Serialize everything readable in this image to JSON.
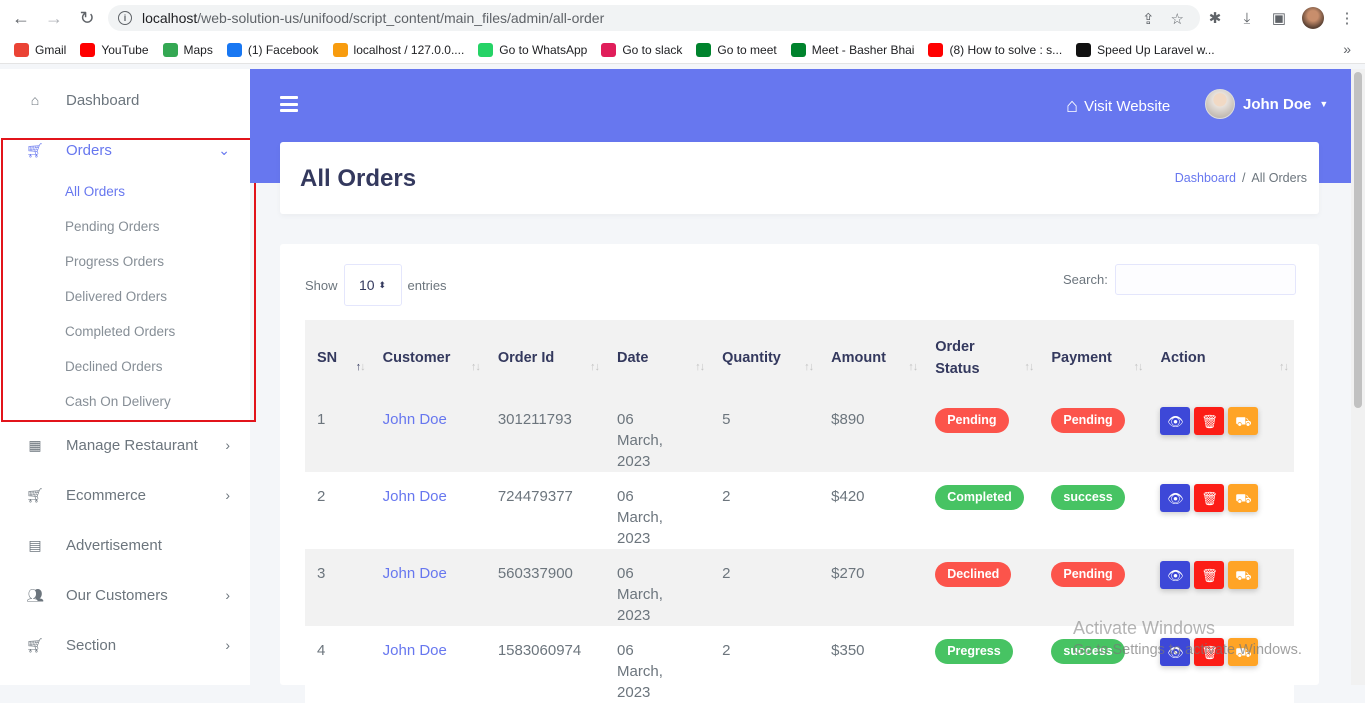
{
  "browser": {
    "url_host": "localhost",
    "url_path": "/web-solution-us/unifood/script_content/main_files/admin/all-order",
    "bookmarks": [
      {
        "label": "Gmail",
        "icon": "gmail-icon",
        "color": "#ea4335"
      },
      {
        "label": "YouTube",
        "icon": "youtube-icon",
        "color": "#ff0000"
      },
      {
        "label": "Maps",
        "icon": "maps-icon",
        "color": "#34a853"
      },
      {
        "label": "(1) Facebook",
        "icon": "facebook-icon",
        "color": "#1877f2"
      },
      {
        "label": "localhost / 127.0.0....",
        "icon": "phpmyadmin-icon",
        "color": "#f89c0e"
      },
      {
        "label": "Go to WhatsApp",
        "icon": "whatsapp-icon",
        "color": "#25d366"
      },
      {
        "label": "Go to slack",
        "icon": "slack-icon",
        "color": "#e01e5a"
      },
      {
        "label": "Go to meet",
        "icon": "meet-icon",
        "color": "#00832d"
      },
      {
        "label": "Meet - Basher Bhai",
        "icon": "meet-icon",
        "color": "#00832d"
      },
      {
        "label": "(8) How to solve : s...",
        "icon": "youtube-icon",
        "color": "#ff0000"
      },
      {
        "label": "Speed Up Laravel w...",
        "icon": "laravel-icon",
        "color": "#111111"
      }
    ]
  },
  "sidebar": {
    "items": [
      {
        "label": "Dashboard",
        "icon": "home-icon",
        "chevron": ""
      },
      {
        "label": "Orders",
        "icon": "cart-icon",
        "chevron": "⌄"
      },
      {
        "label": "Manage Restaurant",
        "icon": "grid-icon",
        "chevron": "›"
      },
      {
        "label": "Ecommerce",
        "icon": "cart-icon",
        "chevron": "›"
      },
      {
        "label": "Advertisement",
        "icon": "ad-icon",
        "chevron": ""
      },
      {
        "label": "Our Customers",
        "icon": "users-icon",
        "chevron": "›"
      },
      {
        "label": "Section",
        "icon": "cart-icon",
        "chevron": "›"
      }
    ],
    "orders_sub": [
      "All Orders",
      "Pending Orders",
      "Progress Orders",
      "Delivered Orders",
      "Completed Orders",
      "Declined Orders",
      "Cash On Delivery"
    ]
  },
  "header": {
    "visit_website": "Visit Website",
    "user_name": "John Doe"
  },
  "page": {
    "title": "All Orders",
    "breadcrumb_home": "Dashboard",
    "breadcrumb_sep": "/",
    "breadcrumb_current": "All Orders"
  },
  "table_controls": {
    "show_label": "Show",
    "entries_value": "10",
    "entries_label": "entries",
    "search_label": "Search:"
  },
  "table": {
    "columns": [
      "SN",
      "Customer",
      "Order Id",
      "Date",
      "Quantity",
      "Amount",
      "Order Status",
      "Payment",
      "Action"
    ],
    "rows": [
      {
        "sn": "1",
        "customer": "John Doe",
        "order_id": "301211793",
        "date": "06 March, 2023",
        "quantity": "5",
        "amount": "$890",
        "status": "Pending",
        "status_color": "#fc544b",
        "payment": "Pending",
        "payment_color": "#fc544b"
      },
      {
        "sn": "2",
        "customer": "John Doe",
        "order_id": "724479377",
        "date": "06 March, 2023",
        "quantity": "2",
        "amount": "$420",
        "status": "Completed",
        "status_color": "#47c363",
        "payment": "success",
        "payment_color": "#47c363"
      },
      {
        "sn": "3",
        "customer": "John Doe",
        "order_id": "560337900",
        "date": "06 March, 2023",
        "quantity": "2",
        "amount": "$270",
        "status": "Declined",
        "status_color": "#fc544b",
        "payment": "Pending",
        "payment_color": "#fc544b"
      },
      {
        "sn": "4",
        "customer": "John Doe",
        "order_id": "1583060974",
        "date": "06 March, 2023",
        "quantity": "2",
        "amount": "$350",
        "status": "Pregress",
        "status_color": "#47c363",
        "payment": "success",
        "payment_color": "#47c363"
      }
    ]
  },
  "watermark": {
    "line1": "Activate Windows",
    "line2": "Go to Settings to activate Windows."
  }
}
